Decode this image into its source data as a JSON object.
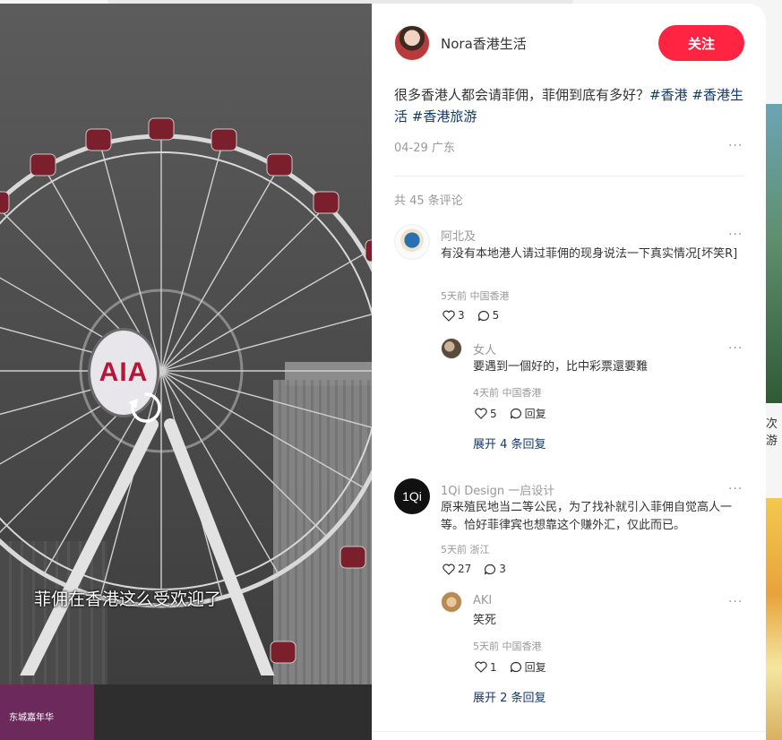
{
  "colors": {
    "accent": "#ff2442",
    "link": "#13386c",
    "muted": "#999999"
  },
  "background": {
    "side_caption": "次游"
  },
  "video": {
    "hub_logo": "AIA",
    "subtitle": "菲佣在香港这么受欢迎了",
    "banner_text": "东城嘉年华",
    "replay_icon": "replay-icon"
  },
  "author": {
    "name": "Nora香港生活",
    "follow_label": "关注"
  },
  "post": {
    "text": "很多香港人都会请菲佣，菲佣到底有多好？",
    "tags": [
      "#香港",
      "#香港生活",
      "#香港旅游"
    ],
    "date": "04-29",
    "location": "广东",
    "more": "···"
  },
  "comments": {
    "count_label": "共 45 条评论",
    "items": [
      {
        "name": "阿北及",
        "text": "有没有本地港人请过菲佣的现身说法一下真实情况[坏笑R]",
        "time": "5天前",
        "location": "中国香港",
        "likes": "3",
        "replies": "5",
        "more": "···",
        "sub": {
          "name": "女人",
          "text": "要遇到一個好的，比中彩票還要難",
          "time": "4天前",
          "location": "中国香港",
          "likes": "5",
          "reply_label": "回复",
          "more": "···"
        },
        "expand_label": "展开 4 条回复"
      },
      {
        "name": "1Qi Design 一启设计",
        "avatar_text": "1Qi",
        "text": "原来殖民地当二等公民，为了找补就引入菲佣自觉高人一等。恰好菲律宾也想靠这个赚外汇，仅此而已。",
        "time": "5天前",
        "location": "浙江",
        "likes": "27",
        "replies": "3",
        "more": "···",
        "sub": {
          "name": "AKI",
          "text": "笑死",
          "time": "5天前",
          "location": "中国香港",
          "likes": "1",
          "reply_label": "回复",
          "more": "···"
        },
        "expand_label": "展开 2 条回复"
      }
    ]
  }
}
